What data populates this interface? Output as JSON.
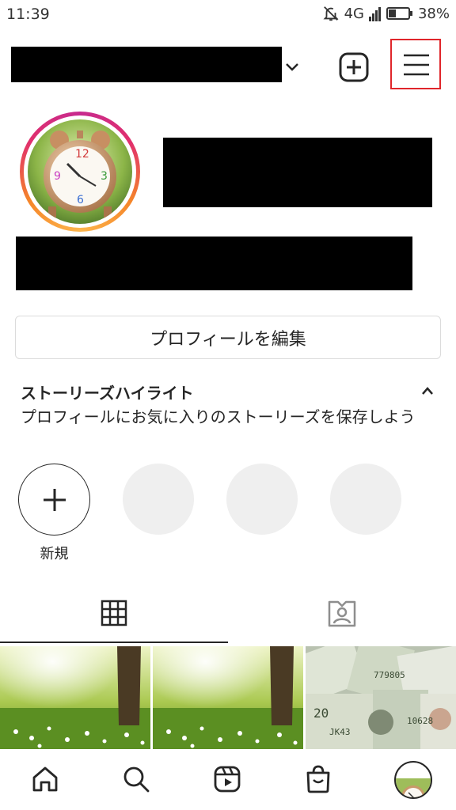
{
  "status_bar": {
    "time": "11:39",
    "network": "4G",
    "battery_percent": "38%",
    "battery_level": 0.38,
    "icons": [
      "mute-bell-icon",
      "signal-icon",
      "battery-icon"
    ]
  },
  "header": {
    "username_redacted": true,
    "icons": [
      "chevron-down-icon",
      "add-post-icon",
      "hamburger-menu-icon"
    ],
    "menu_highlight_color": "#e0262b"
  },
  "profile": {
    "avatar_icon": "alarm-clock-photo",
    "story_ring_colors": [
      "#c72a8f",
      "#e1306c",
      "#f58529",
      "#fdb64d"
    ],
    "edit_button_label": "プロフィールを編集"
  },
  "highlights": {
    "title": "ストーリーズハイライト",
    "description": "プロフィールにお気に入りのストーリーズを保存しよう",
    "new_label": "新規",
    "placeholder_count": 3
  },
  "tabs": [
    {
      "icon": "grid-icon",
      "active": true
    },
    {
      "icon": "tagged-person-icon",
      "active": false
    }
  ],
  "posts": [
    {
      "image": "forest-sunlight-photo"
    },
    {
      "image": "forest-sunlight-photo"
    },
    {
      "image": "dollar-bills-photo"
    }
  ],
  "bottom_nav": [
    {
      "icon": "home-icon"
    },
    {
      "icon": "search-icon"
    },
    {
      "icon": "reels-icon"
    },
    {
      "icon": "shop-icon"
    },
    {
      "icon": "profile-avatar"
    }
  ],
  "colors": {
    "text": "#262626",
    "border": "#dbdbdb",
    "placeholder": "#efefef"
  }
}
